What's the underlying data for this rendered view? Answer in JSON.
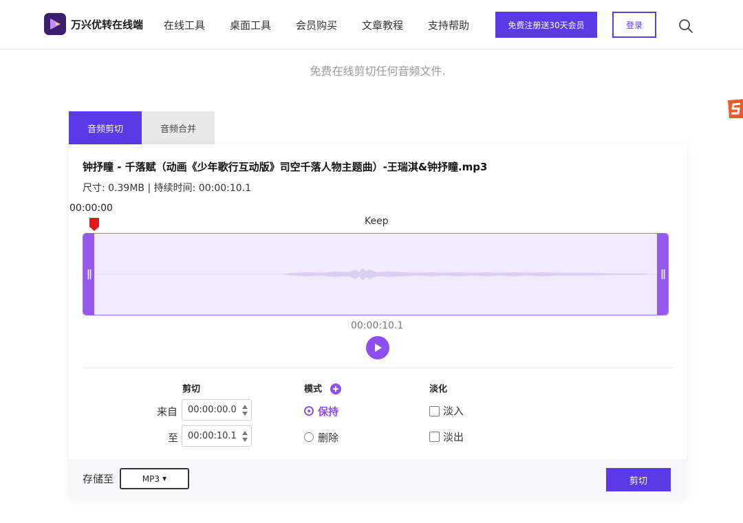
{
  "nav": {
    "brand": "万兴优转在线端",
    "items": [
      "在线工具",
      "桌面工具",
      "会员购买",
      "文章教程",
      "支持帮助"
    ],
    "register_button": "免费注册送30天会员",
    "login_button": "登录"
  },
  "subtitle": "免费在线剪切任何音频文件.",
  "tabs": [
    {
      "label": "音频剪切",
      "active": true
    },
    {
      "label": "音频合并",
      "active": false
    }
  ],
  "file": {
    "title": "钟抒瞳 - 千落赋（动画《少年歌行互动版》司空千落人物主题曲）-王瑞淇&钟抒瞳.mp3",
    "info": "尺寸: 0.39MB | 持续时间: 00:00:10.1"
  },
  "player": {
    "start_time": "00:00:00",
    "selection_label": "Keep",
    "end_time": "00:00:10.1"
  },
  "controls": {
    "cut": {
      "heading": "剪切",
      "from_label": "来自",
      "from_value": "00:00:00.0",
      "to_label": "至",
      "to_value": "00:00:10.1"
    },
    "mode": {
      "heading": "模式",
      "options": [
        {
          "label": "保持",
          "selected": true
        },
        {
          "label": "删除",
          "selected": false
        }
      ]
    },
    "fade": {
      "heading": "淡化",
      "options": [
        {
          "label": "淡入",
          "checked": false
        },
        {
          "label": "淡出",
          "checked": false
        }
      ]
    }
  },
  "footer": {
    "save_label": "存储至",
    "format": "MP3",
    "cut_button": "剪切"
  },
  "colors": {
    "brand": "#5b3ae6",
    "accent": "#8f4ff0",
    "selection_fill": "#f2ebfd"
  }
}
